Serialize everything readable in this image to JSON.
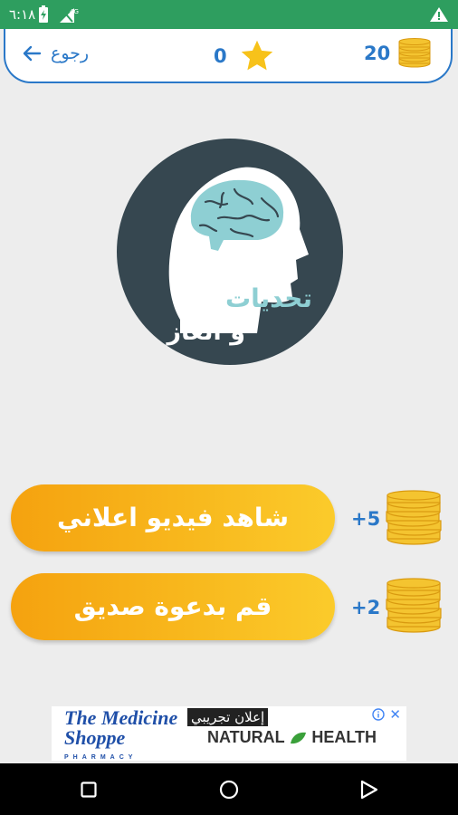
{
  "status_bar": {
    "time": "٦:١٨",
    "icons": [
      "battery-charging-icon",
      "signal-4g-icon",
      "warning-icon"
    ]
  },
  "header": {
    "back_label": "رجوع",
    "stars_count": "0",
    "coins_count": "20",
    "colors": {
      "accent": "#2a78c8",
      "star": "#f7c21a",
      "coin": "#f4c430"
    }
  },
  "logo": {
    "line1": "تحديات",
    "line2": "و ألغاز",
    "colors": {
      "circle": "#364750",
      "brain": "#8ecfd3"
    }
  },
  "actions": [
    {
      "label": "شاهد فيديو اعلاني",
      "reward": "+5"
    },
    {
      "label": "قم بدعوة صديق",
      "reward": "+2"
    }
  ],
  "ad": {
    "tag": "إعلان تجريبي",
    "brand_left_line1": "The Medicine",
    "brand_left_line2": "Shoppe",
    "brand_left_line3": "PHARMACY",
    "brand_right_1": "NATURAL",
    "brand_right_2": "HEALTH"
  },
  "nav": {
    "icons": [
      "recents-square-icon",
      "home-circle-icon",
      "back-triangle-icon"
    ]
  }
}
